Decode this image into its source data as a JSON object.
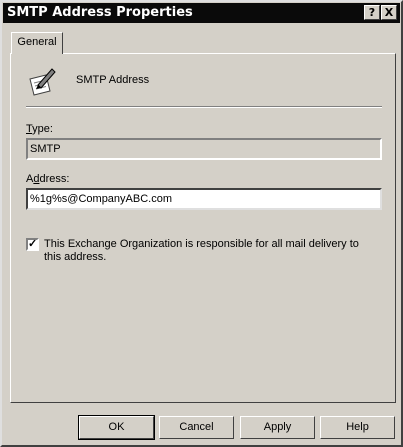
{
  "window": {
    "title": "SMTP Address Properties"
  },
  "title_buttons": {
    "help": "?",
    "close": "X"
  },
  "tabs": [
    {
      "label": "General"
    }
  ],
  "header": {
    "label": "SMTP Address",
    "icon": "pen-and-paper-icon"
  },
  "type_field": {
    "label": "Type:",
    "value": "SMTP"
  },
  "address_field": {
    "label": "Address:",
    "value": "%1g%s@CompanyABC.com"
  },
  "responsibility_checkbox": {
    "checked": true,
    "label": "This Exchange Organization is responsible for all mail delivery to this address."
  },
  "buttons": {
    "ok": "OK",
    "cancel": "Cancel",
    "apply": "Apply",
    "help": "Help"
  },
  "colors": {
    "face": "#d4d0c8",
    "titlebar": "#0a0a0a"
  }
}
